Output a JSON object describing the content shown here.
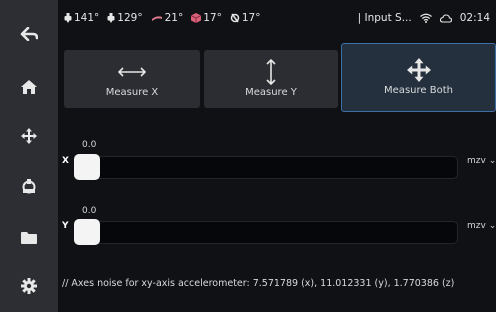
{
  "sidebar": {
    "items": [
      {
        "icon": "back-arrow-icon"
      },
      {
        "icon": "home-icon"
      },
      {
        "icon": "move-icon"
      },
      {
        "icon": "extruder-icon"
      },
      {
        "icon": "folder-icon"
      },
      {
        "icon": "gear-icon"
      }
    ]
  },
  "status_bar": {
    "temps": [
      {
        "icon": "extruder-temp-icon",
        "value": "141°"
      },
      {
        "icon": "extruder-temp-icon",
        "value": "129°"
      },
      {
        "icon": "bed-temp-icon",
        "value": "21°"
      },
      {
        "icon": "chamber-temp-icon",
        "value": "17°"
      },
      {
        "icon": "mcu-temp-icon",
        "value": "17°"
      }
    ],
    "input_label": "| Input S...",
    "time": "02:14"
  },
  "tiles": [
    {
      "label": "Measure X",
      "icon": "horizontal-arrow-icon",
      "active": false
    },
    {
      "label": "Measure Y",
      "icon": "vertical-arrow-icon",
      "active": false
    },
    {
      "label": "Measure Both",
      "icon": "move-arrows-icon",
      "active": true
    }
  ],
  "axes": [
    {
      "label": "X",
      "value": "0.0",
      "unit": "mzv",
      "level": 0
    },
    {
      "label": "Y",
      "value": "0.0",
      "unit": "mzv",
      "level": 0
    }
  ],
  "footer": "// Axes noise for xy-axis accelerometer: 7.571789 (x), 11.012331 (y), 1.770386 (z)",
  "colors": {
    "sidebar_bg": "#2c2e33",
    "tile_bg": "#2b2d32",
    "active_border": "#3d6fa6",
    "background": "#101114"
  }
}
